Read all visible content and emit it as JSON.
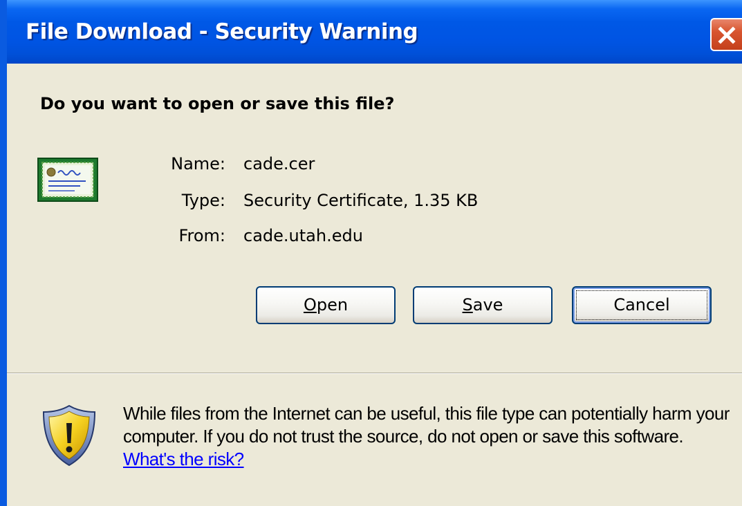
{
  "window": {
    "title": "File Download - Security Warning",
    "close_icon": "close-icon"
  },
  "dialog": {
    "question": "Do you want to open or save this file?",
    "file_icon": "certificate-icon",
    "fields": [
      {
        "label": "Name:",
        "value": "cade.cer"
      },
      {
        "label": "Type:",
        "value": "Security Certificate, 1.35 KB"
      },
      {
        "label": "From:",
        "value": "cade.utah.edu"
      }
    ],
    "buttons": {
      "open": {
        "mnemonic": "O",
        "rest": "pen"
      },
      "save": {
        "mnemonic": "S",
        "rest": "ave"
      },
      "cancel": {
        "label": "Cancel"
      }
    }
  },
  "warning": {
    "icon": "shield-warning-icon",
    "text": "While files from the Internet can be useful, this file type can potentially harm your computer. If you do not trust the source, do not open or save this software.",
    "link_text": "What's the risk?"
  },
  "colors": {
    "titlebar": "#0054e3",
    "dialog_bg": "#ece9d8",
    "close_button": "#d8552f",
    "link": "#0000ff"
  }
}
